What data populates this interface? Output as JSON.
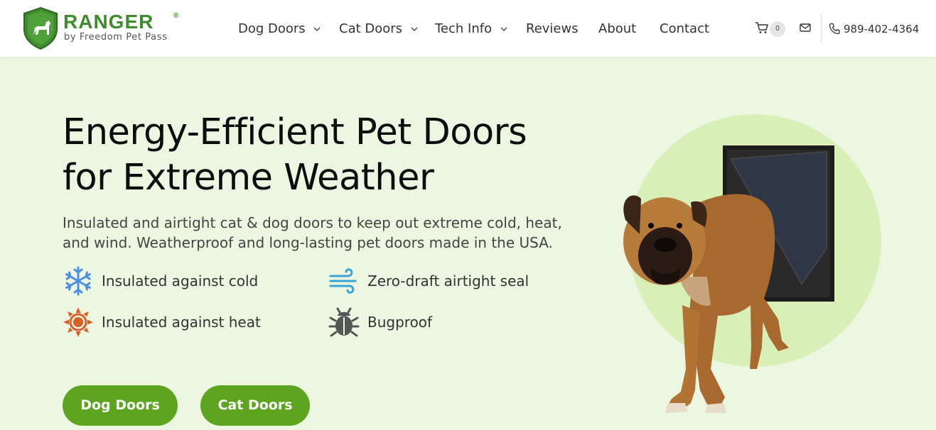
{
  "brand": {
    "name": "RANGER",
    "registered": "®",
    "tagline": "by Freedom Pet Pass",
    "color": "#3f8d2d"
  },
  "nav": {
    "items": [
      {
        "label": "Dog Doors",
        "has_dropdown": true
      },
      {
        "label": "Cat Doors",
        "has_dropdown": true
      },
      {
        "label": "Tech Info",
        "has_dropdown": true
      },
      {
        "label": "Reviews",
        "has_dropdown": false
      },
      {
        "label": "About",
        "has_dropdown": false
      },
      {
        "label": "Contact",
        "has_dropdown": false
      }
    ]
  },
  "header": {
    "cart_count": "0",
    "phone": "989-402-4364",
    "icons": [
      "cart-icon",
      "mail-icon",
      "phone-icon"
    ]
  },
  "hero": {
    "title_line1": "Energy-Efficient Pet Doors",
    "title_line2": "for Extreme Weather",
    "description": "Insulated and airtight cat & dog doors to keep out extreme cold, heat, and wind. Weatherproof and long-lasting pet doors made in the USA.",
    "features": [
      {
        "label": "Insulated against cold",
        "icon": "snowflake-icon",
        "color": "#4a8fe7"
      },
      {
        "label": "Zero-draft airtight seal",
        "icon": "wind-icon",
        "color": "#3aa3d8"
      },
      {
        "label": "Insulated against heat",
        "icon": "sun-icon",
        "color": "#d9602a"
      },
      {
        "label": "Bugproof",
        "icon": "bug-icon",
        "color": "#555555"
      }
    ],
    "buttons": [
      {
        "label": "Dog Doors"
      },
      {
        "label": "Cat Doors"
      }
    ]
  },
  "colors": {
    "accent": "#5da51e",
    "hero_bg": "#edf6e1",
    "circle": "#d9efb8"
  }
}
